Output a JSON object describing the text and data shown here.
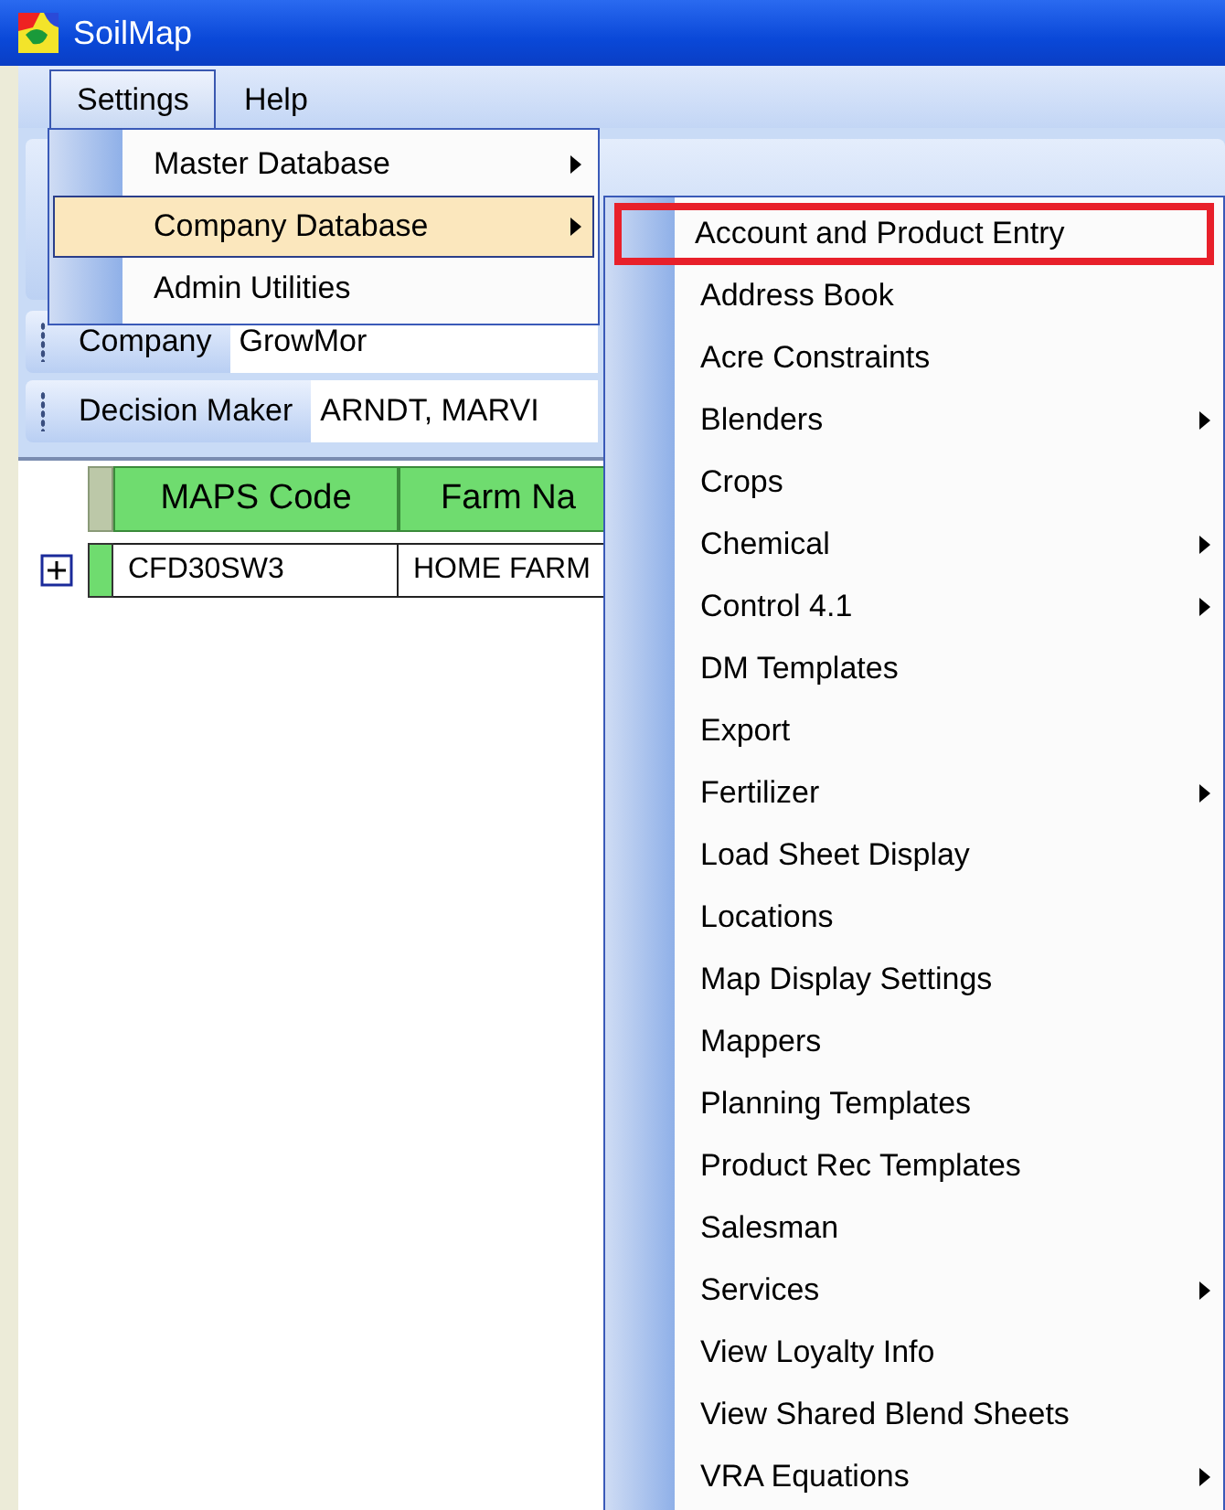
{
  "window": {
    "title": "SoilMap"
  },
  "menubar": [
    {
      "label": "Settings",
      "selected": true
    },
    {
      "label": "Help",
      "selected": false
    }
  ],
  "settings_menu": [
    {
      "label": "Master Database",
      "selected": false,
      "has_submenu": true
    },
    {
      "label": "Company Database",
      "selected": true,
      "has_submenu": true
    },
    {
      "label": "Admin Utilities",
      "selected": false,
      "has_submenu": false
    }
  ],
  "company_database_menu": [
    {
      "label": "Account and Product Entry",
      "outlined": true,
      "has_submenu": false
    },
    {
      "label": "Address Book",
      "outlined": false,
      "has_submenu": false
    },
    {
      "label": "Acre Constraints",
      "outlined": false,
      "has_submenu": false
    },
    {
      "label": "Blenders",
      "outlined": false,
      "has_submenu": true
    },
    {
      "label": "Crops",
      "outlined": false,
      "has_submenu": false
    },
    {
      "label": "Chemical",
      "outlined": false,
      "has_submenu": true
    },
    {
      "label": "Control 4.1",
      "outlined": false,
      "has_submenu": true
    },
    {
      "label": "DM Templates",
      "outlined": false,
      "has_submenu": false
    },
    {
      "label": "Export",
      "outlined": false,
      "has_submenu": false
    },
    {
      "label": "Fertilizer",
      "outlined": false,
      "has_submenu": true
    },
    {
      "label": "Load Sheet Display",
      "outlined": false,
      "has_submenu": false
    },
    {
      "label": "Locations",
      "outlined": false,
      "has_submenu": false
    },
    {
      "label": "Map Display Settings",
      "outlined": false,
      "has_submenu": false
    },
    {
      "label": "Mappers",
      "outlined": false,
      "has_submenu": false
    },
    {
      "label": "Planning Templates",
      "outlined": false,
      "has_submenu": false
    },
    {
      "label": "Product Rec Templates",
      "outlined": false,
      "has_submenu": false
    },
    {
      "label": "Salesman",
      "outlined": false,
      "has_submenu": false
    },
    {
      "label": "Services",
      "outlined": false,
      "has_submenu": true
    },
    {
      "label": "View Loyalty Info",
      "outlined": false,
      "has_submenu": false
    },
    {
      "label": "View Shared Blend Sheets",
      "outlined": false,
      "has_submenu": false
    },
    {
      "label": "VRA Equations",
      "outlined": false,
      "has_submenu": true
    }
  ],
  "fields": [
    {
      "label": "Company",
      "value": "GrowMor"
    },
    {
      "label": "Decision Maker",
      "value": "ARNDT, MARVI"
    }
  ],
  "grid": {
    "columns": [
      "MAPS Code",
      "Farm Na"
    ],
    "rows": [
      {
        "expanded": false,
        "cells": [
          "CFD30SW3",
          "HOME FARM"
        ]
      }
    ]
  }
}
